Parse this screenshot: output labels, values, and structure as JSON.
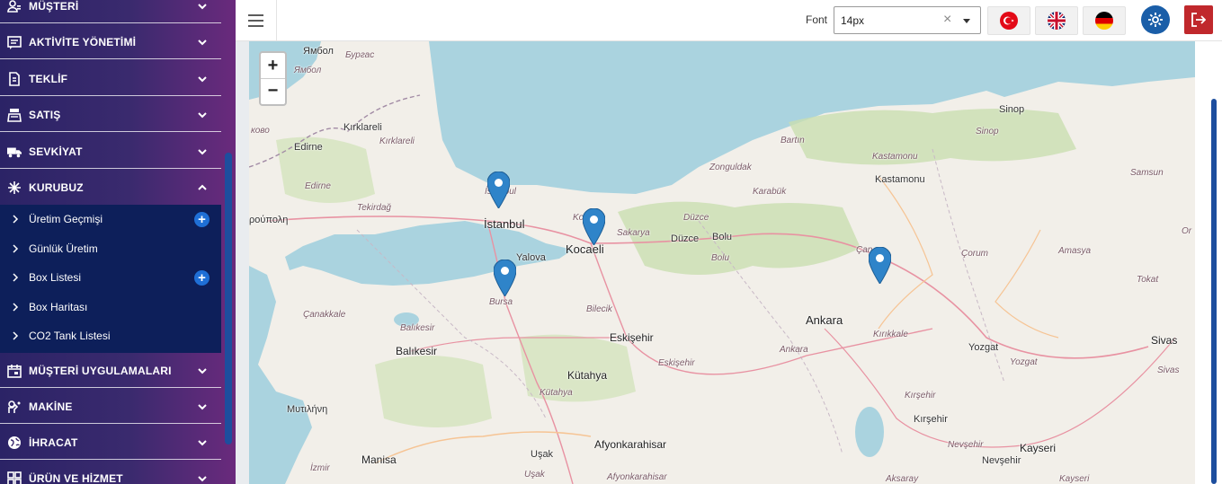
{
  "sidebar": {
    "items": [
      {
        "label": "MÜŞTERİ",
        "icon": "customers-icon"
      },
      {
        "label": "AKTİVİTE YÖNETİMİ",
        "icon": "activity-icon"
      },
      {
        "label": "TEKLİF",
        "icon": "offer-document-icon"
      },
      {
        "label": "SATIŞ",
        "icon": "sales-register-icon"
      },
      {
        "label": "SEVKİYAT",
        "icon": "truck-icon"
      },
      {
        "label": "KURUBUZ",
        "icon": "snowflake-icon"
      },
      {
        "label": "MÜŞTERİ UYGULAMALARI",
        "icon": "calendar-icon"
      },
      {
        "label": "MAKİNE",
        "icon": "machine-icon"
      },
      {
        "label": "İHRACAT",
        "icon": "globe-icon"
      },
      {
        "label": "ÜRÜN VE HİZMET",
        "icon": "product-icon"
      }
    ],
    "submenu": [
      {
        "label": "Üretim Geçmişi",
        "has_add": true
      },
      {
        "label": "Günlük Üretim",
        "has_add": false
      },
      {
        "label": "Box Listesi",
        "has_add": true
      },
      {
        "label": "Box Haritası",
        "has_add": false
      },
      {
        "label": "CO2 Tank Listesi",
        "has_add": false
      }
    ]
  },
  "topbar": {
    "font_label": "Font",
    "font_value": "14px",
    "languages": [
      "tr-flag-icon",
      "uk-flag-icon",
      "de-flag-icon"
    ]
  },
  "map": {
    "zoom_in": "+",
    "zoom_out": "−",
    "labels": {
      "yambol_bg": "Ямбол",
      "yambol_bg2": "Ямбол",
      "burgas": "Бургас",
      "kirklareli": "Kırklareli",
      "kirklareli_r": "Kırklareli",
      "edirne": "Edirne",
      "edirne_r": "Edirne",
      "kovo": "ково",
      "tekirdag_r": "Tekirdağ",
      "istanbul": "İstanbul",
      "istanbul_r": "İstanbul",
      "kocaeli": "Kocaeli",
      "kocaeli_r": "Ko",
      "yalova": "Yalova",
      "bursa": "Bursa",
      "roupoli": "ρούπολη",
      "canakkale_r": "Çanakkale",
      "balikesir": "Balıkesir",
      "balikesir_r": "Balıkesir",
      "bilecik_r": "Bilecik",
      "sakarya_r": "Sakarya",
      "duzce": "Düzce",
      "duzce_r": "Düzce",
      "bolu": "Bolu",
      "bolu_r": "Bolu",
      "zonguldak_r": "Zonguldak",
      "karabuk_r": "Karabük",
      "bartin_r": "Bartın",
      "kastamonu": "Kastamonu",
      "kastamonu_r": "Kastamonu",
      "sinop": "Sinop",
      "sinop_r": "Sinop",
      "samsun_r": "Samsun",
      "cankiri_r": "Çan",
      "corum_r": "Çorum",
      "amasya_r": "Amasya",
      "tokat_r": "Tokat",
      "ordu_r": "Or",
      "ankara": "Ankara",
      "ankara_r": "Ankara",
      "kirikkale_r": "Kırıkkale",
      "yozgat": "Yozgat",
      "yozgat_r": "Yozgat",
      "sivas": "Sivas",
      "sivas_r": "Sivas",
      "eskisehir": "Eskişehir",
      "eskisehir_r": "Eskişehir",
      "kutahya": "Kütahya",
      "kutahya_r": "Kütahya",
      "kirsehir": "Kırşehir",
      "kirsehir_r": "Kırşehir",
      "nevsehir": "Nevşehir",
      "nevsehir_r": "Nevşehir",
      "kayseri": "Kayseri",
      "kayseri_r": "Kayseri",
      "aksaray_r": "Aksaray",
      "afyon": "Afyonkarahisar",
      "afyon_r": "Afyonkarahisar",
      "usak": "Uşak",
      "usak_r": "Uşak",
      "manisa": "Manisa",
      "izmir_r": "İzmir",
      "mytilini": "Μυτιλήνη"
    }
  }
}
